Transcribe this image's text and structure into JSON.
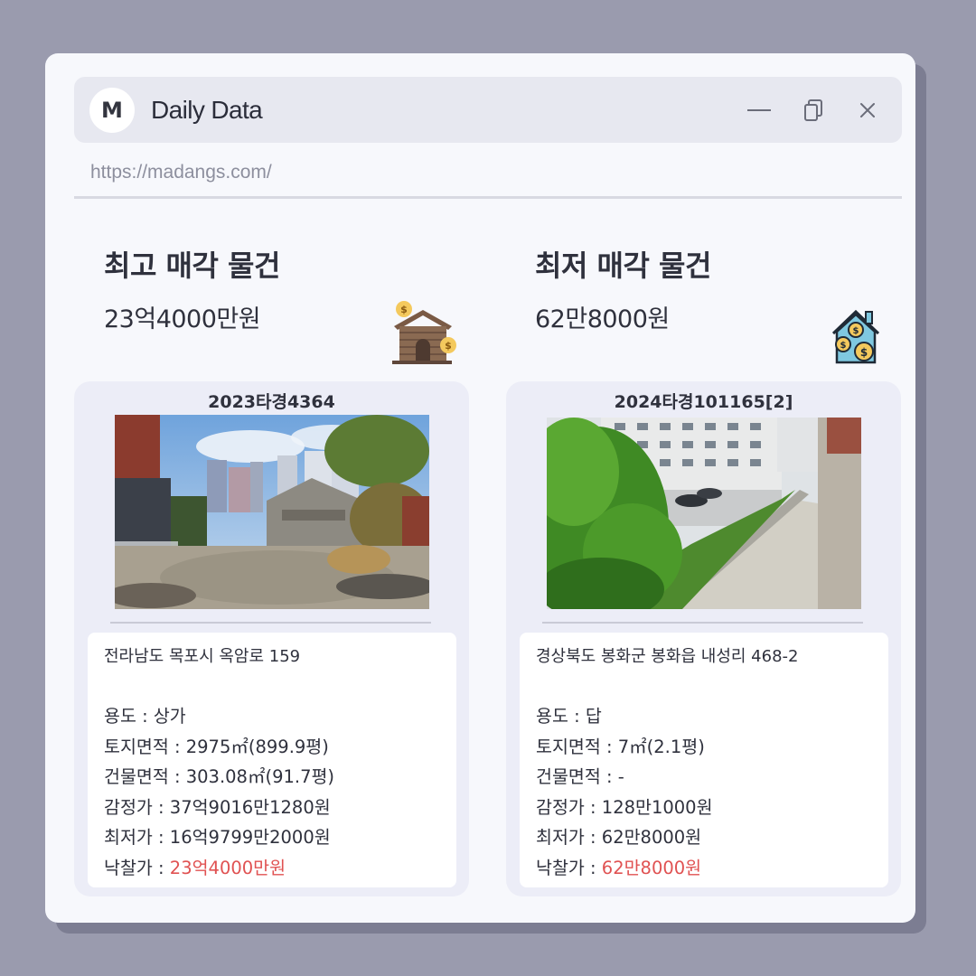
{
  "window": {
    "logo_letter": "M",
    "title": "Daily Data",
    "url": "https://madangs.com/"
  },
  "summary": {
    "highest": {
      "title": "최고 매각 물건",
      "value": "23억4000만원",
      "icon": "house-money-icon"
    },
    "lowest": {
      "title": "최저 매각 물건",
      "value": "62만8000원",
      "icon": "home-coins-icon"
    }
  },
  "listings": [
    {
      "case_no": "2023타경4364",
      "address": "전라남도 목포시 옥암로 159",
      "fields": [
        {
          "label": "용도 : ",
          "value": "상가"
        },
        {
          "label": "토지면적 : ",
          "value": "2975㎡(899.9평)"
        },
        {
          "label": "건물면적 : ",
          "value": "303.08㎡(91.7평)"
        },
        {
          "label": "감정가 : ",
          "value": "37억9016만1280원"
        },
        {
          "label": "최저가 : ",
          "value": "16억9799만2000원"
        }
      ],
      "winning_bid": {
        "label": "낙찰가 : ",
        "value": "23억4000만원"
      }
    },
    {
      "case_no": "2024타경101165[2]",
      "address": "경상북도 봉화군 봉화읍 내성리 468-2",
      "fields": [
        {
          "label": "용도 : ",
          "value": "답"
        },
        {
          "label": "토지면적 : ",
          "value": "7㎡(2.1평)"
        },
        {
          "label": "건물면적 : ",
          "value": "-"
        },
        {
          "label": "감정가 : ",
          "value": "128만1000원"
        },
        {
          "label": "최저가 : ",
          "value": "62만8000원"
        }
      ],
      "winning_bid": {
        "label": "낙찰가 : ",
        "value": "62만8000원"
      }
    }
  ],
  "colors": {
    "accent_red": "#e05252",
    "background": "#9a9bae"
  }
}
